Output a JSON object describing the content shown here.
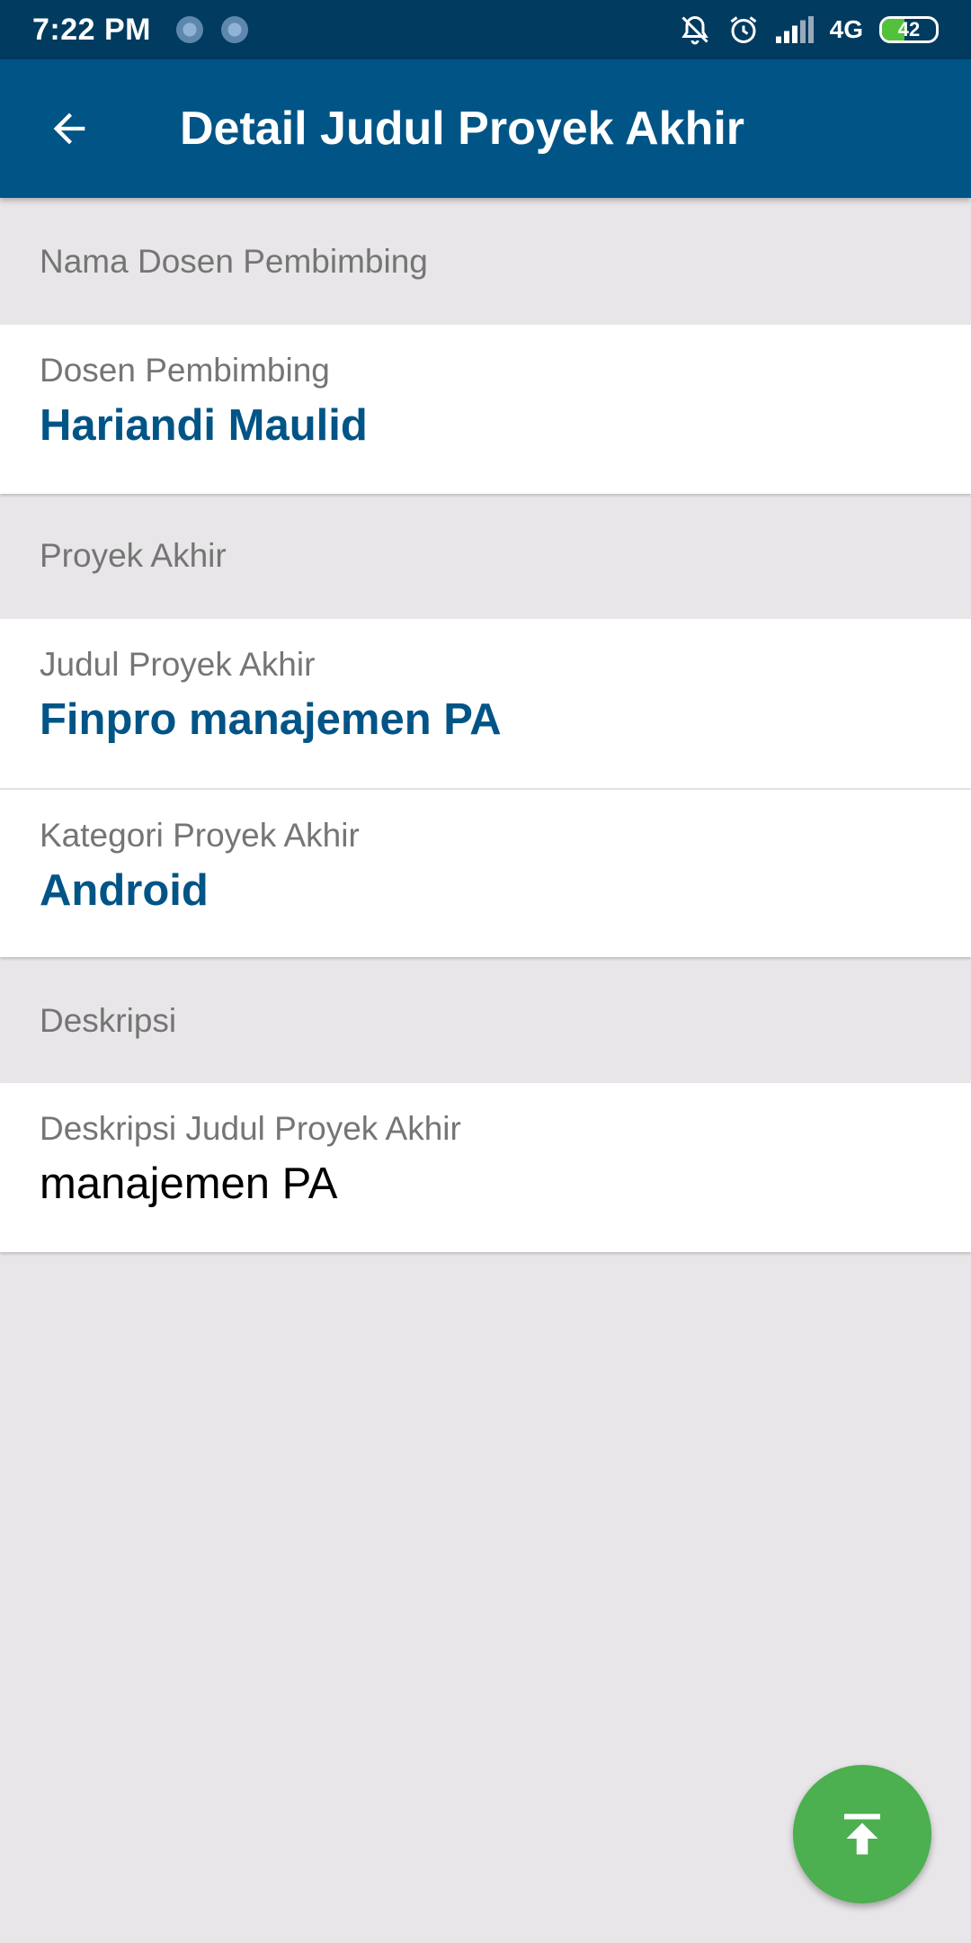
{
  "status_bar": {
    "time": "7:22 PM",
    "network": "4G",
    "battery_level": "42",
    "battery_fraction": 0.42,
    "icons": [
      "notification-dot-icon",
      "notification-dot-icon",
      "silent-bell-icon",
      "alarm-icon",
      "signal-icon"
    ]
  },
  "app_bar": {
    "title": "Detail Judul Proyek Akhir",
    "back_icon": "arrow-left-icon"
  },
  "sections": {
    "supervisor": {
      "header": "Nama Dosen Pembimbing",
      "label": "Dosen Pembimbing",
      "value": "Hariandi Maulid"
    },
    "project": {
      "header": "Proyek Akhir",
      "title_label": "Judul Proyek Akhir",
      "title_value": "Finpro manajemen PA",
      "category_label": "Kategori Proyek Akhir",
      "category_value": "Android"
    },
    "description": {
      "header": "Deskripsi",
      "label": "Deskripsi Judul Proyek Akhir",
      "value": "manajemen PA"
    }
  },
  "fab": {
    "icon": "scroll-to-top-icon"
  },
  "colors": {
    "status_bar": "#013b60",
    "app_bar": "#015486",
    "accent_text": "#015486",
    "fab": "#4caf50",
    "background": "#e8e6e8"
  }
}
